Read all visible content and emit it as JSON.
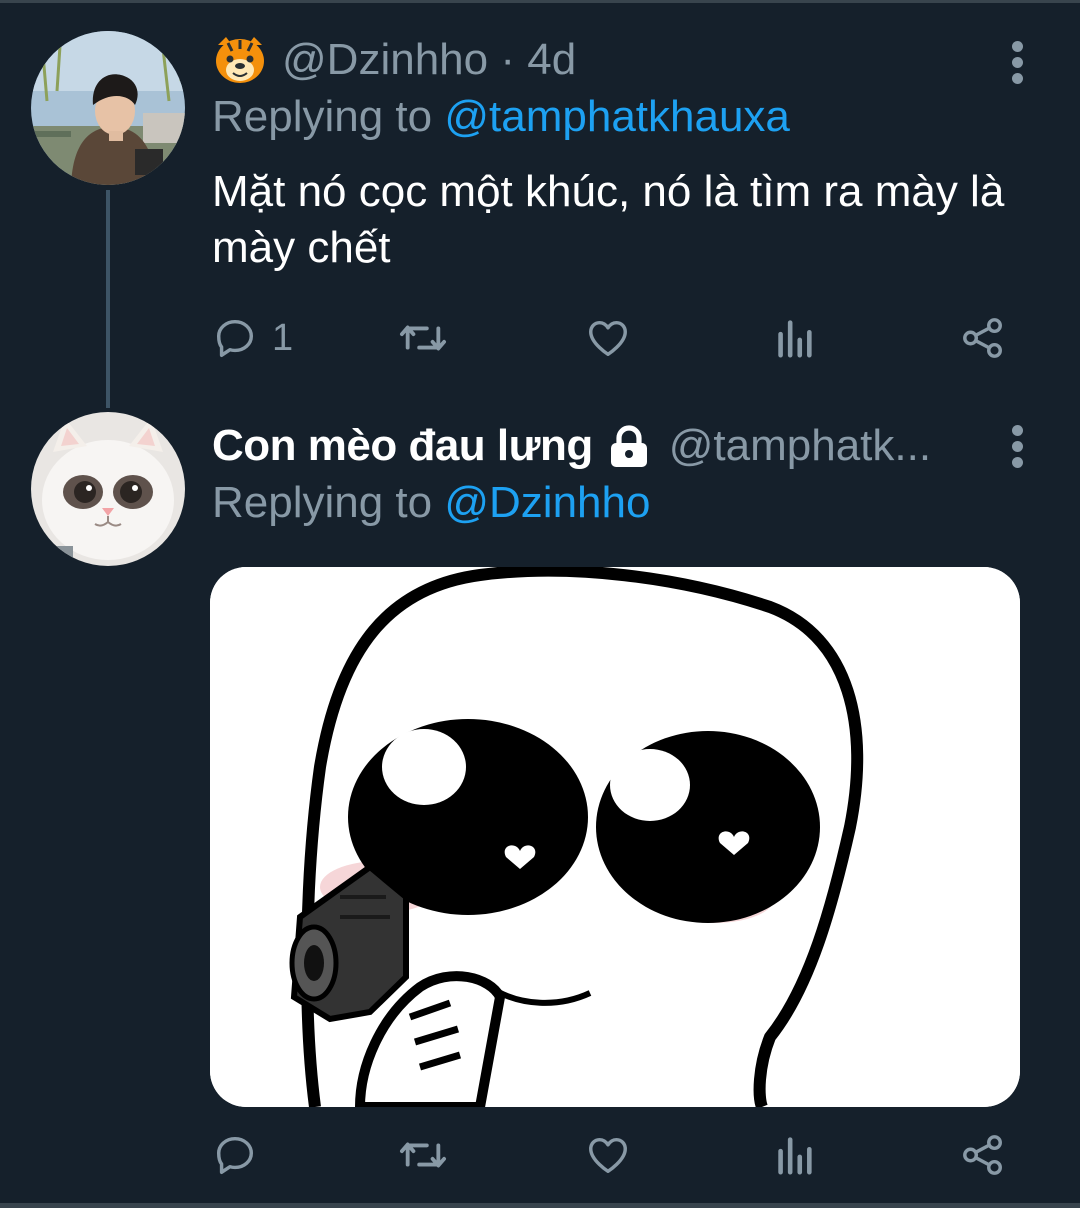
{
  "tweets": [
    {
      "handle": "@Dzinhho",
      "separator": " · ",
      "time": "4d",
      "replying_prefix": "Replying to ",
      "replying_to": "@tamphatkhauxa",
      "text": "Mặt nó cọc một khúc, nó là tìm ra mày là mày chết",
      "reply_count": "1",
      "avatar_icon": "person-photo-avatar",
      "emoji_icon": "tiger-face-icon"
    },
    {
      "display_name": "Con mèo đau lưng",
      "protected_icon": "lock-icon",
      "handle": "@tamphatk...",
      "replying_prefix": "Replying to ",
      "replying_to": "@Dzinhho",
      "reply_count": "",
      "avatar_icon": "cat-photo-avatar",
      "media_description_icon": "meme-character-pointing-gun"
    }
  ],
  "colors": {
    "background": "#15202b",
    "muted": "#8899a6",
    "link": "#1da1f2",
    "text": "#ffffff",
    "thread_line": "#3d5466"
  }
}
